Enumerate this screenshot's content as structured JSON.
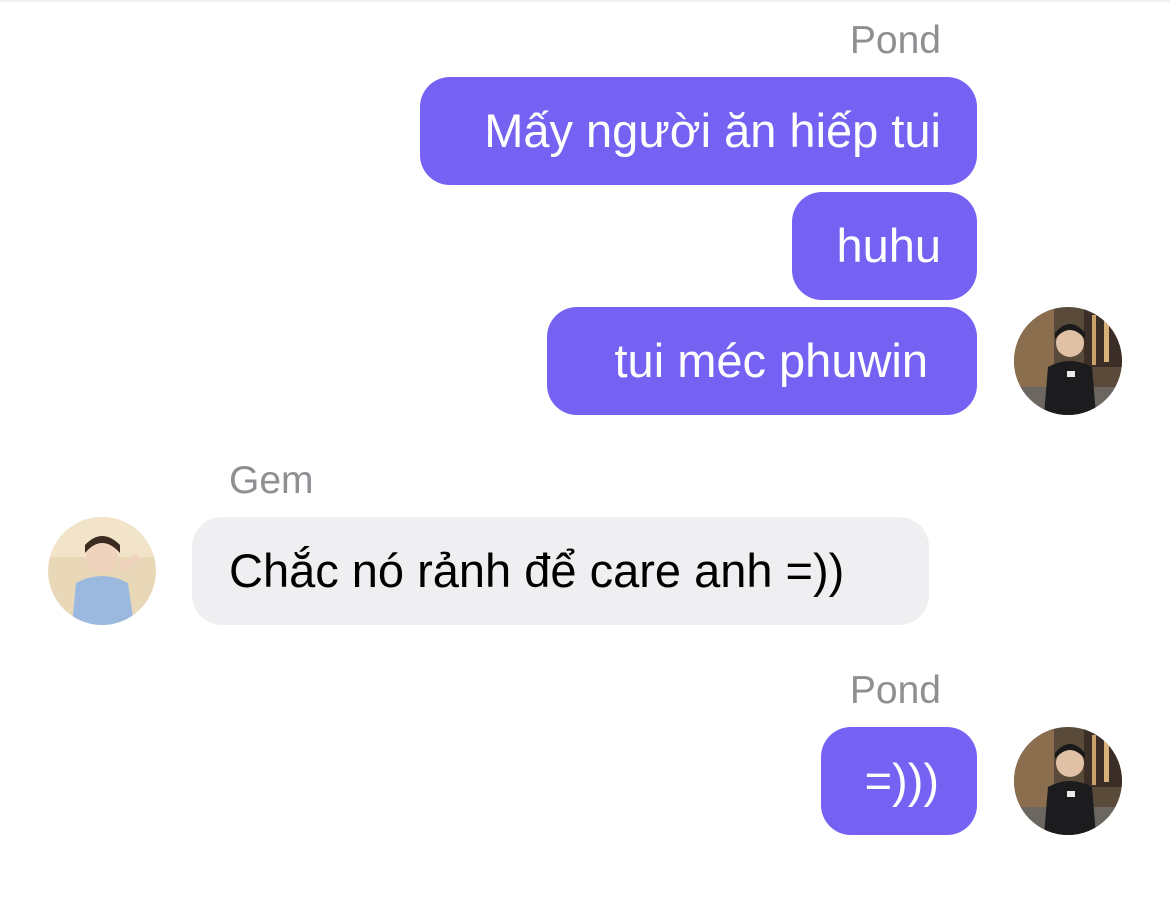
{
  "conversation": {
    "groups": [
      {
        "sender": "Pond",
        "direction": "outgoing",
        "messages": [
          "Mấy người ăn hiếp tui",
          "huhu",
          "tui méc phuwin"
        ]
      },
      {
        "sender": "Gem",
        "direction": "incoming",
        "messages": [
          "Chắc nó rảnh để care anh =))"
        ]
      },
      {
        "sender": "Pond",
        "direction": "outgoing",
        "messages": [
          "=)))"
        ]
      }
    ]
  },
  "colors": {
    "outgoing_bubble": "#7562f3",
    "incoming_bubble": "#efeff2",
    "sender_label": "#8e8e93"
  }
}
